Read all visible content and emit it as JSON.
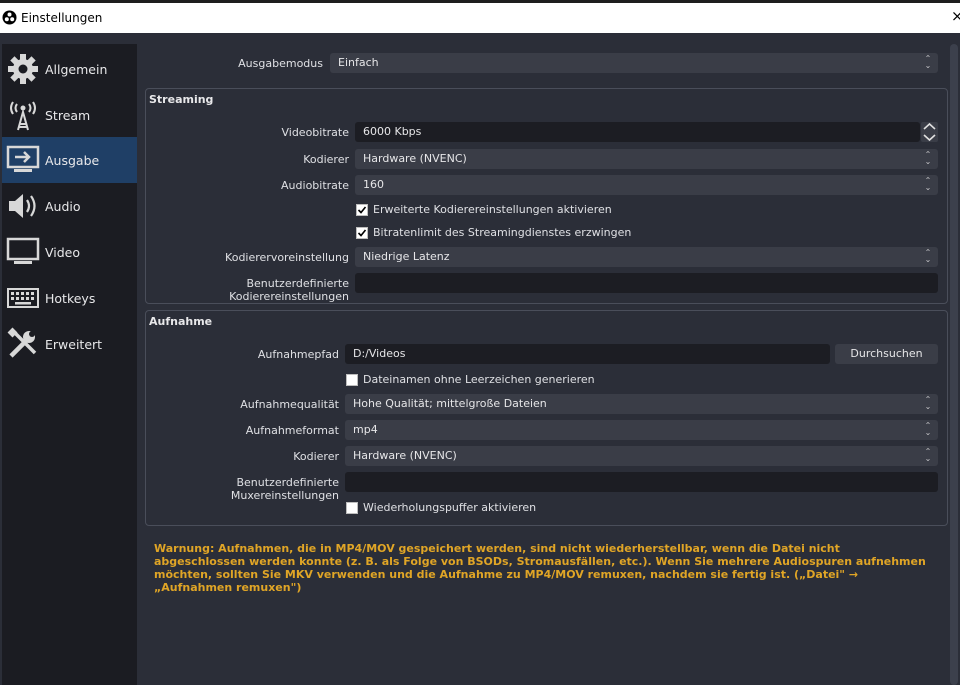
{
  "window": {
    "title": "Einstellungen",
    "close": "×"
  },
  "sidebar": {
    "items": [
      {
        "label": "Allgemein",
        "icon": "gear-icon"
      },
      {
        "label": "Stream",
        "icon": "antenna-icon"
      },
      {
        "label": "Ausgabe",
        "icon": "output-icon",
        "active": true
      },
      {
        "label": "Audio",
        "icon": "speaker-icon"
      },
      {
        "label": "Video",
        "icon": "monitor-icon"
      },
      {
        "label": "Hotkeys",
        "icon": "keyboard-icon"
      },
      {
        "label": "Erweitert",
        "icon": "tools-icon"
      }
    ]
  },
  "output_mode": {
    "label": "Ausgabemodus",
    "value": "Einfach"
  },
  "streaming": {
    "title": "Streaming",
    "video_bitrate": {
      "label": "Videobitrate",
      "value": "6000 Kbps"
    },
    "encoder": {
      "label": "Kodierer",
      "value": "Hardware (NVENC)"
    },
    "audio_bitrate": {
      "label": "Audiobitrate",
      "value": "160"
    },
    "advanced_encoder": {
      "label": "Erweiterte Kodierereinstellungen aktivieren",
      "checked": true
    },
    "enforce_limits": {
      "label": "Bitratenlimit des Streamingdienstes erzwingen",
      "checked": true
    },
    "encoder_preset": {
      "label": "Kodierervoreinstellung",
      "value": "Niedrige Latenz"
    },
    "custom_encoder_settings": {
      "label": "Benutzerdefinierte Kodierereinstellungen",
      "value": ""
    }
  },
  "recording": {
    "title": "Aufnahme",
    "path": {
      "label": "Aufnahmepfad",
      "value": "D:/Videos",
      "browse": "Durchsuchen"
    },
    "no_space": {
      "label": "Dateinamen ohne Leerzeichen generieren",
      "checked": false
    },
    "quality": {
      "label": "Aufnahmequalität",
      "value": "Hohe Qualität; mittelgroße Dateien"
    },
    "format": {
      "label": "Aufnahmeformat",
      "value": "mp4"
    },
    "encoder": {
      "label": "Kodierer",
      "value": "Hardware (NVENC)"
    },
    "custom_muxer": {
      "label": "Benutzerdefinierte Muxereinstellungen",
      "value": ""
    },
    "replay_buffer": {
      "label": "Wiederholungspuffer aktivieren",
      "checked": false
    }
  },
  "warning": "Warnung: Aufnahmen, die in MP4/MOV gespeichert werden, sind nicht wiederherstellbar, wenn die Datei nicht abgeschlossen werden konnte (z. B. als Folge von BSODs, Stromausfällen, etc.). Wenn Sie mehrere Audiospuren aufnehmen möchten, sollten Sie MKV verwenden und die Aufnahme zu MP4/MOV remuxen, nachdem sie fertig ist. („Datei\" → „Aufnahmen remuxen\")",
  "colors": {
    "accent": "#1f3f66",
    "warning": "#e0a526",
    "background": "#2b2e38",
    "sidebar": "#1b1c22"
  }
}
